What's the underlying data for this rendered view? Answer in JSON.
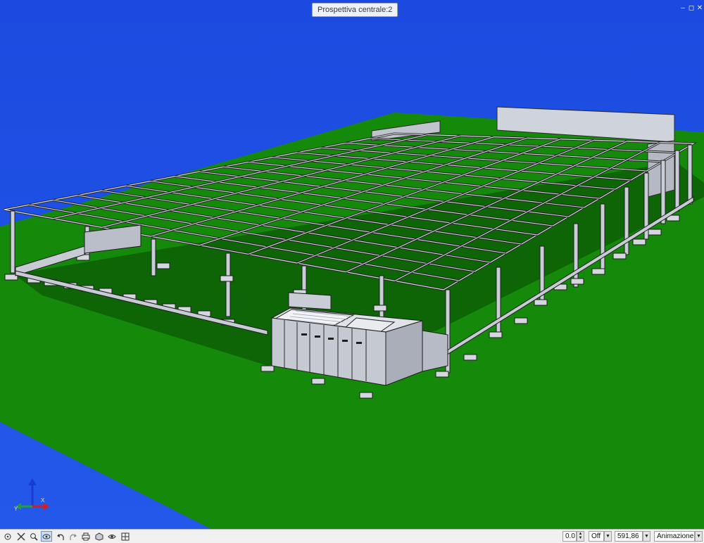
{
  "viewport": {
    "title": "Prospettiva centrale:2",
    "background_color": "#1f4fe0",
    "ground_color": "#158a0a",
    "structure_color": "#c9cdd6"
  },
  "window_controls": [
    "minimize-icon",
    "restore-icon",
    "close-icon"
  ],
  "axis_triad": {
    "labels": [
      "Z",
      "X",
      "Y"
    ],
    "colors": [
      "#1a3ad0",
      "#d02020",
      "#20a030"
    ]
  },
  "toolbar": {
    "icons": [
      "center-view-icon",
      "fit-all-icon",
      "zoom-icon",
      "orbit-icon",
      "undo-view-icon",
      "redo-view-icon",
      "print-icon",
      "render-mode-icon",
      "split-view-icon"
    ],
    "angle_value": "0.0",
    "mode_value": "Off",
    "distance_value": "591,86",
    "animation_label": "Animazione"
  }
}
